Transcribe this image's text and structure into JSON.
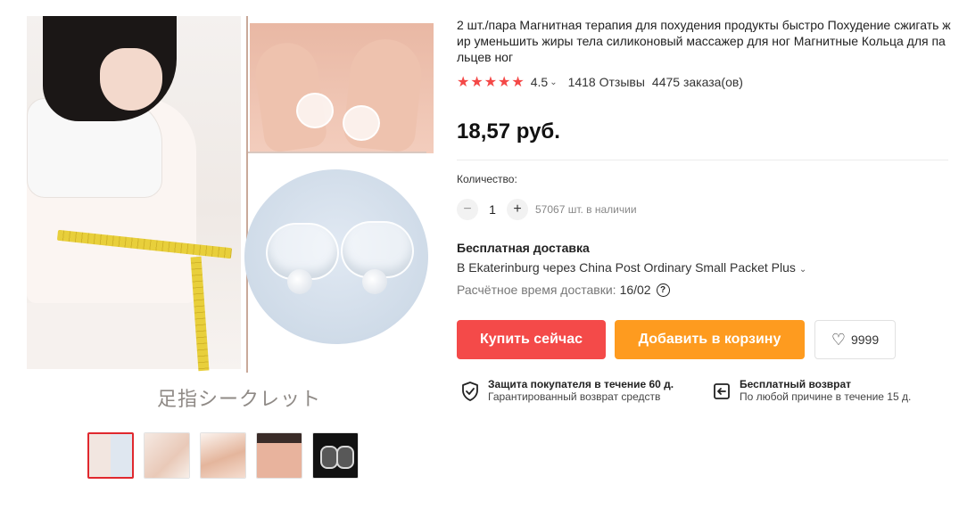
{
  "gallery": {
    "caption": "足指シークレット",
    "thumbnails": [
      {
        "label": "thumb-1",
        "active": true
      },
      {
        "label": "thumb-2",
        "active": false
      },
      {
        "label": "thumb-3",
        "active": false
      },
      {
        "label": "thumb-4",
        "active": false
      },
      {
        "label": "thumb-5",
        "active": false
      }
    ]
  },
  "product": {
    "title": "2 шт./пара Магнитная терапия для похудения продукты быстро Похудение сжигать жир уменьшить жиры тела силиконовый массажер для ног Магнитные Кольца для пальцев ног",
    "stars": "★★★★★",
    "rating": "4.5",
    "reviews": "1418 Отзывы",
    "orders": "4475 заказа(ов)",
    "price": "18,57 руб."
  },
  "quantity": {
    "label": "Количество:",
    "minus": "−",
    "value": "1",
    "plus": "+",
    "stock": "57067 шт. в наличии"
  },
  "shipping": {
    "title": "Бесплатная доставка",
    "method": "В Ekaterinburg через China Post Ordinary Small Packet Plus",
    "time_label": "Расчётное время доставки:",
    "time_value": "16/02",
    "help_glyph": "?"
  },
  "actions": {
    "buy_now": "Купить сейчас",
    "add_to_cart": "Добавить в корзину",
    "wishlist_count": "9999"
  },
  "guarantees": {
    "protection_title": "Защита покупателя в течение 60 д.",
    "protection_sub": "Гарантированный возврат средств",
    "return_title": "Бесплатный возврат",
    "return_sub": "По любой причине в течение 15 д."
  },
  "colors": {
    "accent_red": "#f44a49",
    "accent_orange": "#fe9b1f",
    "star": "#f44847"
  }
}
